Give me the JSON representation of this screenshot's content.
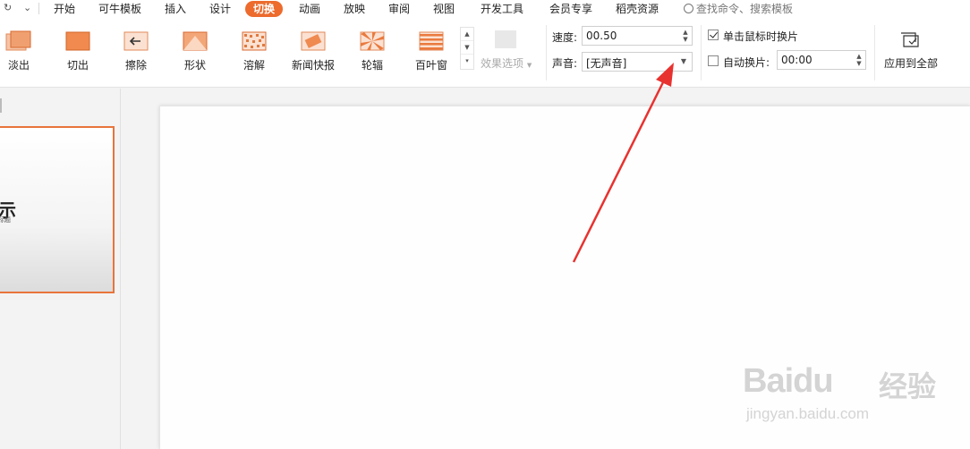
{
  "menubar": {
    "quick_icons": [
      "↻",
      "⌄"
    ],
    "tabs": [
      "开始",
      "可牛模板",
      "插入",
      "设计",
      "切换",
      "动画",
      "放映",
      "审阅",
      "视图",
      "开发工具",
      "会员专享",
      "稻壳资源"
    ],
    "active_tab": "切换",
    "search_label": "查找命令、搜索模板"
  },
  "ribbon": {
    "effects": [
      "淡出",
      "切出",
      "擦除",
      "形状",
      "溶解",
      "新闻快报",
      "轮辐",
      "百叶窗"
    ],
    "effect_options_label": "效果选项",
    "speed_label": "速度:",
    "speed_value": "00.50",
    "sound_label": "声音:",
    "sound_value": "[无声音]",
    "on_click_label": "单击鼠标时换片",
    "on_click_checked": true,
    "auto_label": "自动换片:",
    "auto_checked": false,
    "auto_value": "00:00",
    "apply_all_label": "应用到全部"
  },
  "slides_panel": {
    "thumb_title_fragment": "示",
    "thumb_subtitle_fragment": "标题"
  },
  "watermark": {
    "brand": "Baidu",
    "brand_cn": "经验",
    "url": "jingyan.baidu.com"
  },
  "colors": {
    "accent": "#ec6b2d",
    "annotation_arrow": "#e8322f"
  }
}
